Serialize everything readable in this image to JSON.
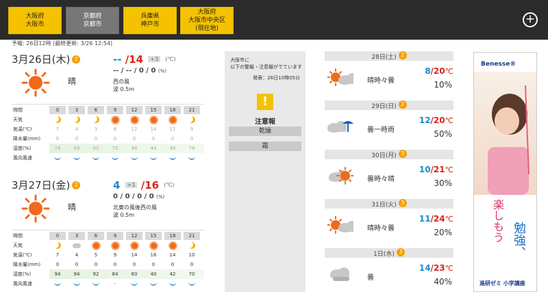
{
  "locations": [
    {
      "label": "大阪府\n大阪市",
      "active": false
    },
    {
      "label": "京都府\n京都市",
      "active": true
    },
    {
      "label": "兵庫県\n神戸市",
      "active": false
    },
    {
      "label": "大阪府\n大阪市中央区\n(現在地)",
      "active": false
    }
  ],
  "add_button": "+",
  "updated": "予報: 26日12時 (最終更新: 3/26 12:54)",
  "days": [
    {
      "date": "3月26日(木)",
      "badge": "2",
      "desc": "晴",
      "min": "--",
      "max": "14",
      "diff": "+3",
      "unit": "(℃)",
      "precip": "-- / -- / 0 / 0",
      "precip_unit": "(%)",
      "wind_wave": "西の風\n波 0.5m",
      "hours": [
        "0",
        "3",
        "6",
        "9",
        "12",
        "15",
        "18",
        "21"
      ],
      "weather": [
        "moon",
        "moon",
        "moon",
        "sun",
        "sun",
        "sun",
        "sun",
        "moon"
      ],
      "temp": [
        "7",
        "4",
        "3",
        "8",
        "12",
        "14",
        "12",
        "9"
      ],
      "rain": [
        "0",
        "0",
        "0",
        "0",
        "0",
        "0",
        "0",
        "0"
      ],
      "humidity": [
        "78",
        "89",
        "92",
        "70",
        "48",
        "44",
        "48",
        "78"
      ],
      "wind": [
        "wind",
        "wind",
        "wind",
        "wind",
        "wind",
        "wind",
        "wind",
        "wind"
      ]
    },
    {
      "date": "3月27日(金)",
      "badge": "2",
      "desc": "晴",
      "min": "4",
      "max": "16",
      "diff": "+1",
      "unit": "(℃)",
      "precip": "0 / 0 / 0 / 0",
      "precip_unit": "(%)",
      "wind_wave": "北東の風後西の風\n波 0.5m",
      "hours": [
        "0",
        "3",
        "6",
        "9",
        "12",
        "15",
        "18",
        "21"
      ],
      "weather": [
        "moon",
        "cloud",
        "sun",
        "sun",
        "sun",
        "sun",
        "sun",
        "moon"
      ],
      "temp": [
        "7",
        "4",
        "5",
        "9",
        "14",
        "16",
        "14",
        "10"
      ],
      "rain": [
        "0",
        "0",
        "0",
        "0",
        "0",
        "0",
        "0",
        "0"
      ],
      "humidity": [
        "94",
        "94",
        "92",
        "84",
        "60",
        "40",
        "42",
        "70"
      ],
      "wind": [
        "wind",
        "wind",
        "wind",
        "-",
        "wind",
        "wind",
        "wind",
        "wind"
      ]
    }
  ],
  "grid_labels": {
    "time": "時間",
    "weather": "天気",
    "temp": "気温(℃)",
    "rain": "降水量(mm)",
    "humidity": "湿度(%)",
    "wind": "風向風速"
  },
  "warning": {
    "title": "大阪市に\n以下の警報・注意報がでています",
    "time": "発表：26日10時05分",
    "icon": "!",
    "type": "注意報",
    "items": [
      "乾燥",
      "霜"
    ]
  },
  "week": [
    {
      "date": "28日(土)",
      "badge": "2",
      "desc": "晴時々曇",
      "min": "8",
      "max": "20",
      "unit": "℃",
      "pop": "10%",
      "icon": "sun-cloud"
    },
    {
      "date": "29日(日)",
      "badge": "2",
      "desc": "曇一時雨",
      "min": "12",
      "max": "20",
      "unit": "℃",
      "pop": "50%",
      "icon": "cloud-umbrella"
    },
    {
      "date": "30日(月)",
      "badge": "3",
      "desc": "曇時々晴",
      "min": "10",
      "max": "21",
      "unit": "℃",
      "pop": "30%",
      "icon": "cloud-sun"
    },
    {
      "date": "31日(火)",
      "badge": "3",
      "desc": "晴時々曇",
      "min": "11",
      "max": "24",
      "unit": "℃",
      "pop": "20%",
      "icon": "sun-cloud"
    },
    {
      "date": "1日(水)",
      "badge": "3",
      "desc": "曇",
      "min": "14",
      "max": "23",
      "unit": "℃",
      "pop": "40%",
      "icon": "cloud"
    }
  ],
  "ad": {
    "brand": "Benesse®",
    "copy1": "勉強、",
    "copy2": "楽しもう",
    "footer": "進研ゼミ 小学講座"
  },
  "colors": {
    "accent": "#f5c200",
    "max": "#d8261a",
    "min": "#1a8ad0",
    "topbar": "#2b2b2b"
  }
}
